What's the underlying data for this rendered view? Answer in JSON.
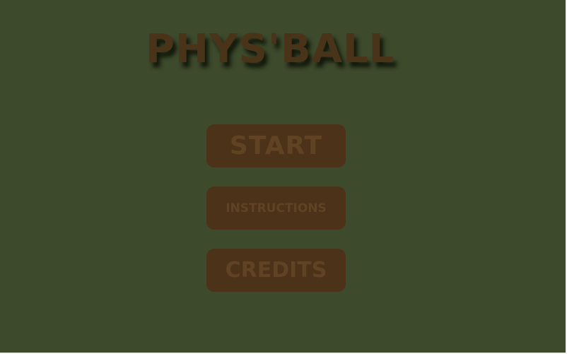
{
  "game": {
    "title": "PHYS'BALL"
  },
  "menu": {
    "start_label": "START",
    "instructions_label": "INSTRUCTIONS",
    "credits_label": "CREDITS"
  },
  "colors": {
    "background": "#3d4a2c",
    "button": "#4c3219",
    "button_text": "#5f4322",
    "title_text": "#4a3419"
  }
}
